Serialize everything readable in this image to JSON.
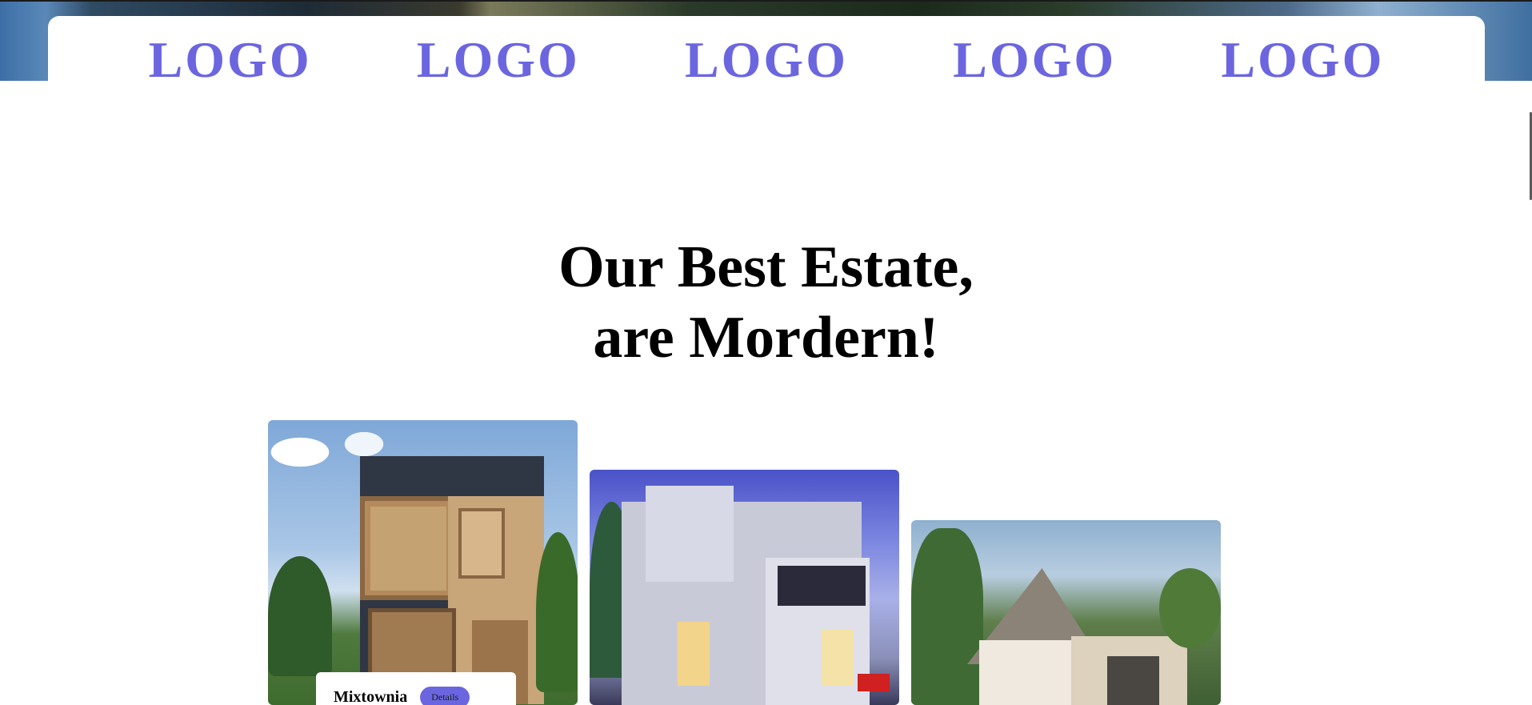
{
  "logos": [
    "LOGO",
    "LOGO",
    "LOGO",
    "LOGO",
    "LOGO"
  ],
  "heading": {
    "line1": "Our Best Estate,",
    "line2": "are Mordern!"
  },
  "cards": [
    {
      "title": "Mixtownia",
      "button_label": "Details"
    }
  ],
  "colors": {
    "accent": "#6b66e0",
    "text": "#000000",
    "background": "#ffffff"
  }
}
